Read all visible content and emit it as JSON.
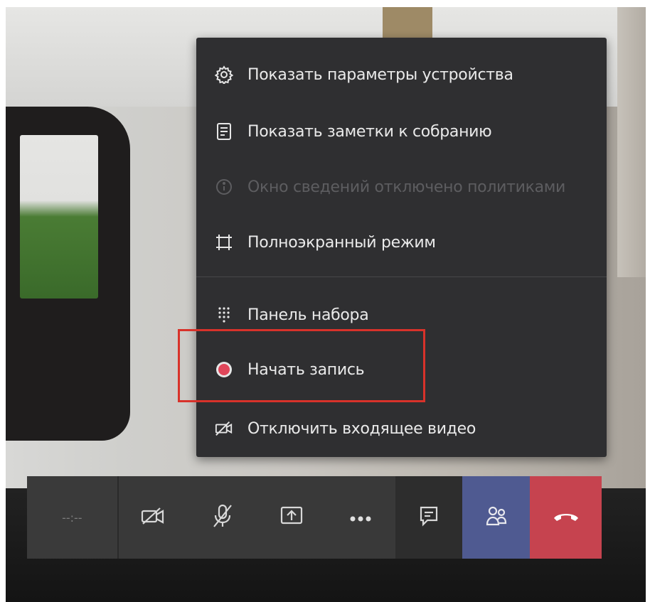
{
  "menu": {
    "items": [
      {
        "icon": "gear-icon",
        "label": "Показать параметры устройства",
        "disabled": false
      },
      {
        "icon": "notes-icon",
        "label": "Показать заметки к собранию",
        "disabled": false
      },
      {
        "icon": "info-icon",
        "label": "Окно сведений отключено политиками",
        "disabled": true
      },
      {
        "icon": "fullscreen-icon",
        "label": "Полноэкранный режим",
        "disabled": false
      },
      {
        "icon": "dialpad-icon",
        "label": "Панель набора",
        "disabled": false
      },
      {
        "icon": "record-icon",
        "label": "Начать запись",
        "disabled": false
      },
      {
        "icon": "video-off-icon",
        "label": "Отключить входящее видео",
        "disabled": false
      }
    ]
  },
  "toolbar": {
    "timer": "--:--",
    "buttons": [
      "camera-off-icon",
      "mic-off-icon",
      "share-screen-icon",
      "more-options-icon",
      "chat-icon",
      "participants-icon",
      "hang-up-icon"
    ]
  },
  "colors": {
    "menu_bg": "#2f2f31",
    "highlight": "#d8322a",
    "record": "#e0465a",
    "people_bg": "#4f5a91",
    "hangup_bg": "#c6434f"
  }
}
